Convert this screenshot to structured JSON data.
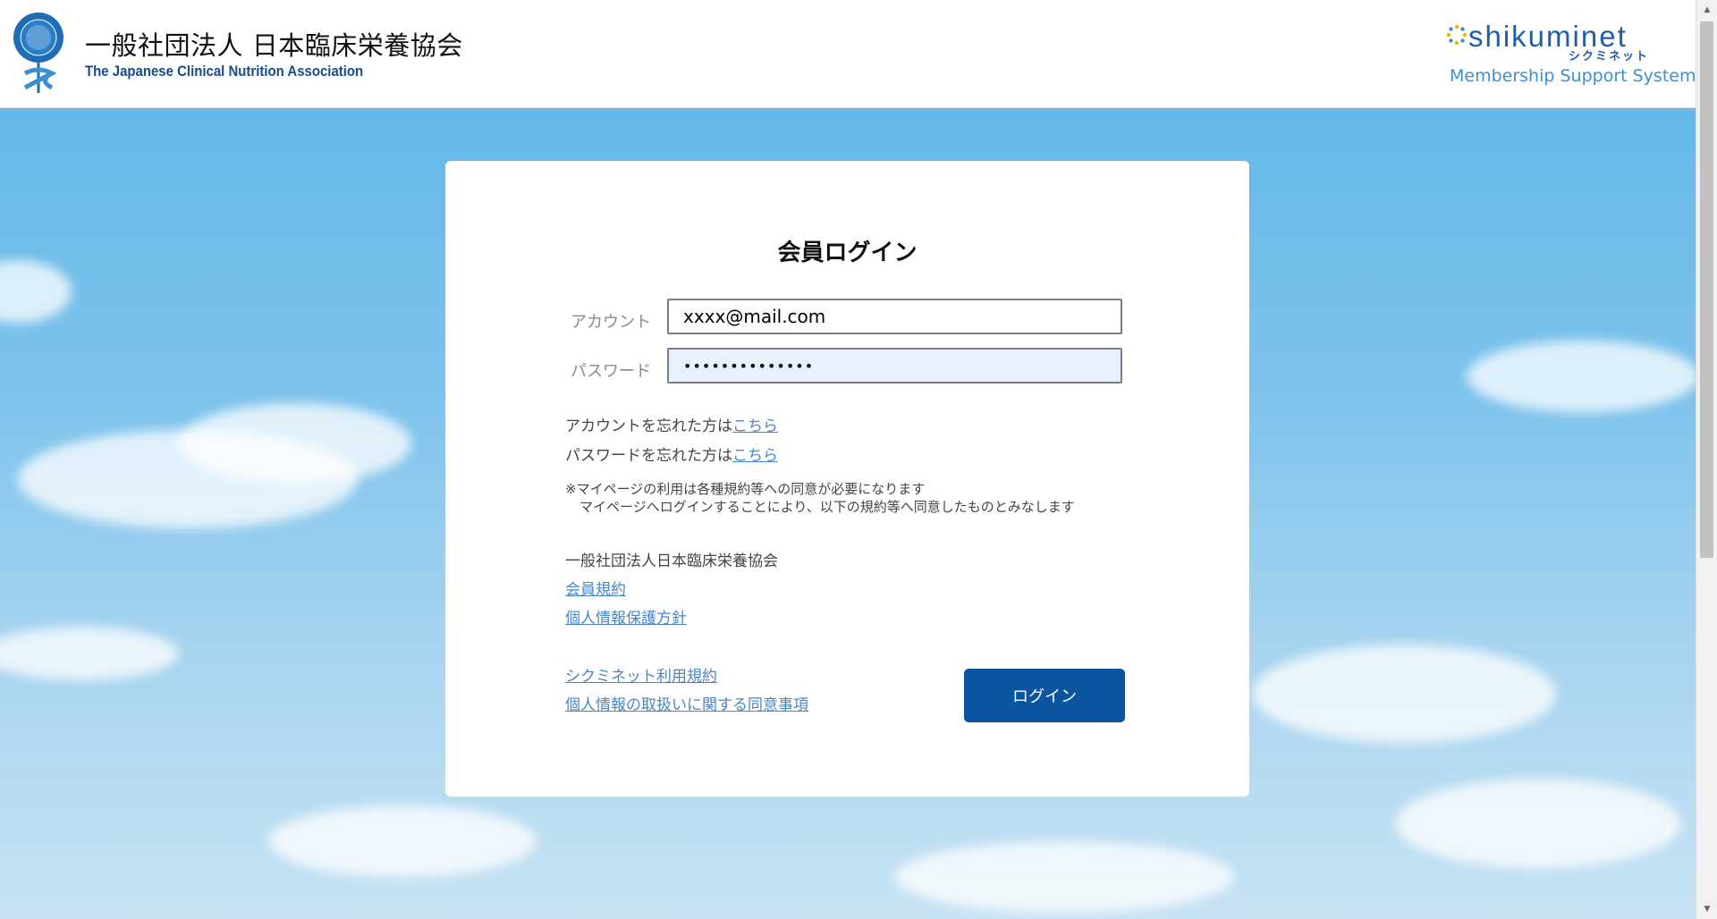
{
  "header": {
    "org_name_ja": "一般社団法人 日本臨床栄養協会",
    "org_name_en": "The Japanese Clinical Nutrition Association",
    "brand_wordmark": "shikuminet",
    "brand_kana": "シクミネット",
    "brand_subtitle": "Membership Support System"
  },
  "login": {
    "title": "会員ログイン",
    "account_label": "アカウント",
    "account_value": "xxxx@mail.com",
    "password_label": "パスワード",
    "password_value": "••••••••••••••",
    "forgot_account_text": "アカウントを忘れた方は",
    "forgot_account_link": "こちら",
    "forgot_password_text": "パスワードを忘れた方は",
    "forgot_password_link": "こちら",
    "notice_line1": "※マイページの利用は各種規約等への同意が必要になります",
    "notice_line2": "マイページへログインすることにより、以下の規約等へ同意したものとみなします",
    "org_section_title": "一般社団法人日本臨床栄養協会",
    "member_terms_link": "会員規約",
    "privacy_policy_link": "個人情報保護方針",
    "shikuminet_terms_link": "シクミネット利用規約",
    "personal_info_consent_link": "個人情報の取扱いに関する同意事項",
    "login_button": "ログイン"
  },
  "colors": {
    "primary_button": "#0b55a0",
    "link": "#4a86c6",
    "brand": "#1f5fa8"
  }
}
